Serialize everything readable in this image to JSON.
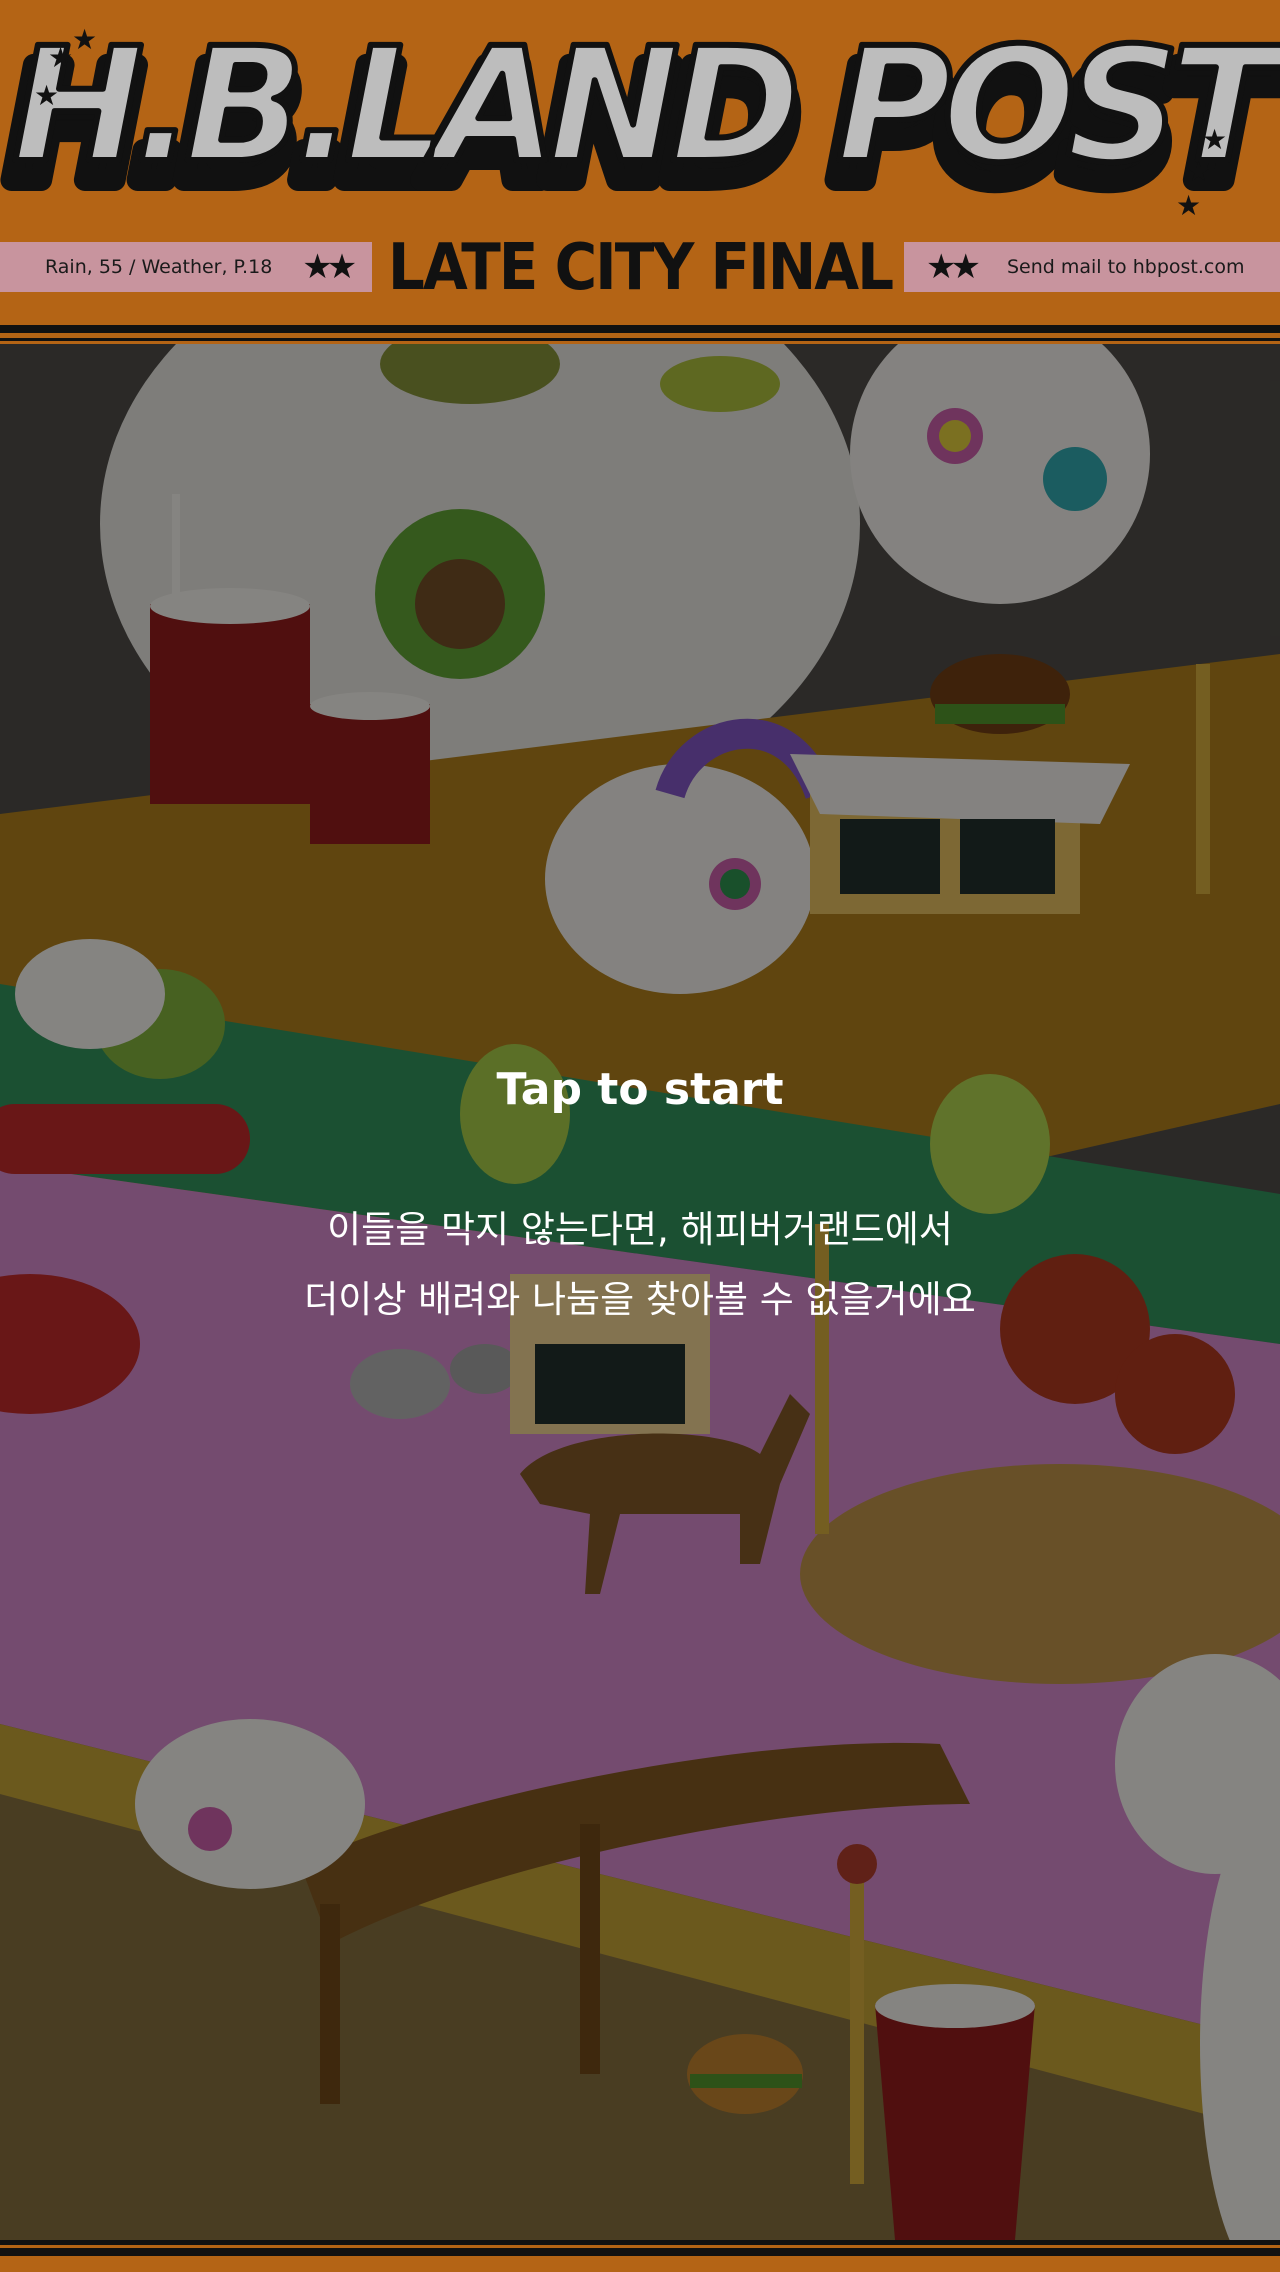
{
  "masthead": {
    "title": "H.B.LAND POST",
    "weather": "Rain, 55 / Weather, P.18",
    "edition": "LATE CITY FINAL",
    "mail": "Send mail to hbpost.com",
    "left_stars": "★★",
    "right_stars": "★★"
  },
  "start_screen": {
    "tap_label": "Tap to start",
    "message_line1": "이들을 막지 않는다면, 해피버거랜드에서",
    "message_line2": "더이상 배려와 나눔을 찾아볼 수 없을거에요"
  },
  "colors": {
    "masthead_orange": "#b46415",
    "info_pink": "#c8949e",
    "title_gray": "#bdbdbd",
    "ink": "#111111"
  }
}
